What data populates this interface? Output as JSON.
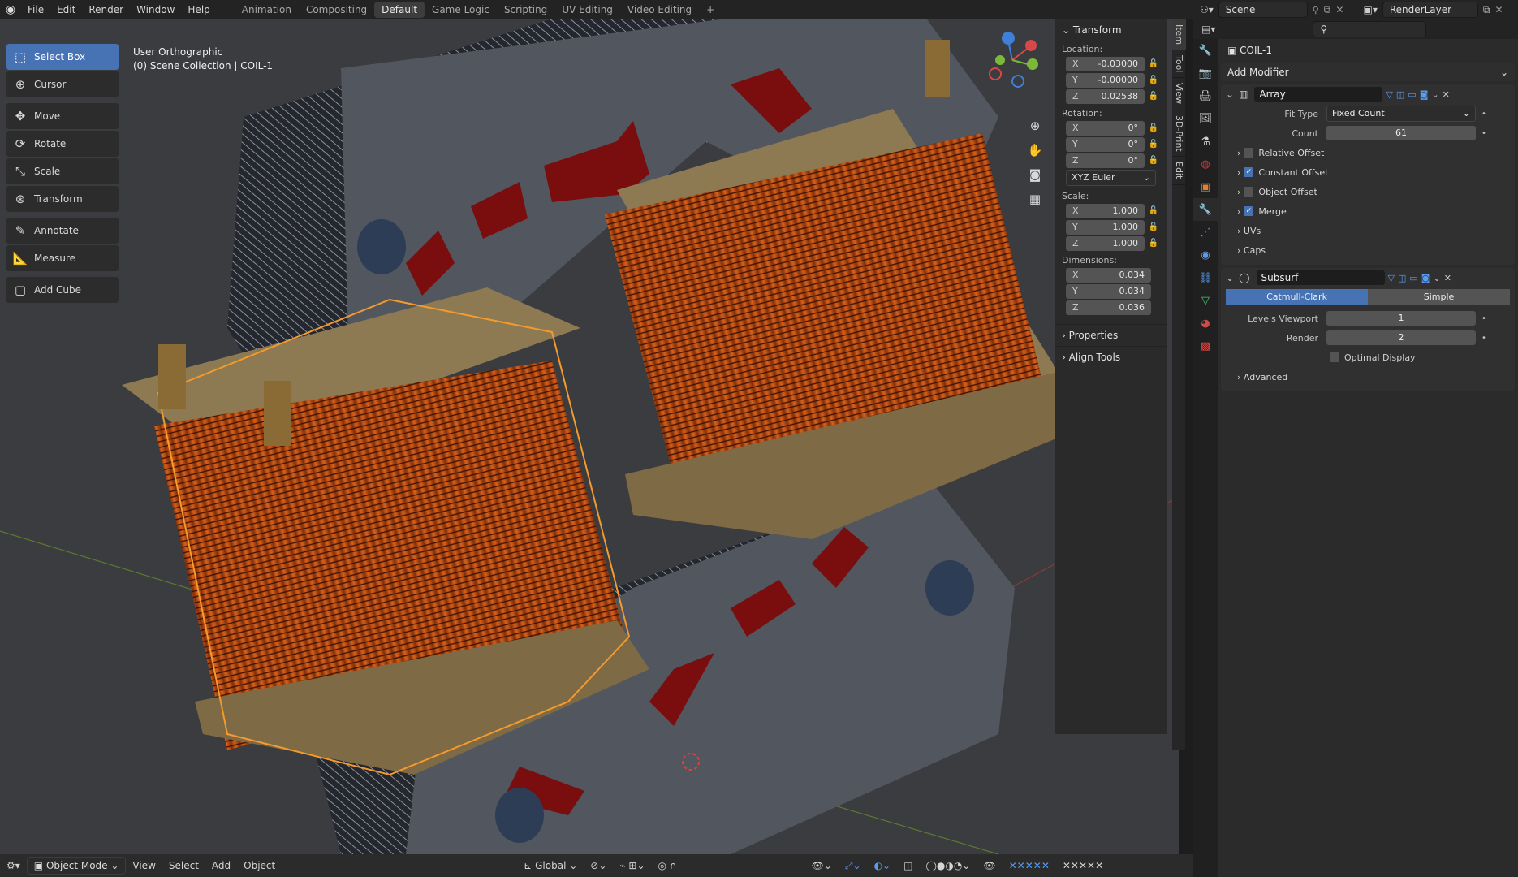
{
  "topbar": {
    "menus": [
      "File",
      "Edit",
      "Render",
      "Window",
      "Help"
    ],
    "tabs": [
      "Animation",
      "Compositing",
      "Default",
      "Game Logic",
      "Scripting",
      "UV Editing",
      "Video Editing"
    ],
    "active_tab": "Default",
    "add": "+",
    "scene": "Scene",
    "render_layer": "RenderLayer"
  },
  "toolbar": {
    "tools": [
      {
        "label": "Select Box",
        "icon": "select-box-icon",
        "active": true
      },
      {
        "label": "Cursor",
        "icon": "cursor-icon"
      },
      {
        "label": "Move",
        "icon": "move-icon"
      },
      {
        "label": "Rotate",
        "icon": "rotate-icon"
      },
      {
        "label": "Scale",
        "icon": "scale-icon"
      },
      {
        "label": "Transform",
        "icon": "transform-icon"
      },
      {
        "label": "Annotate",
        "icon": "annotate-icon"
      },
      {
        "label": "Measure",
        "icon": "measure-icon"
      },
      {
        "label": "Add Cube",
        "icon": "add-cube-icon"
      }
    ]
  },
  "viewport": {
    "view_name": "User Orthographic",
    "collection": "(0) Scene Collection | COIL-1"
  },
  "npanel": {
    "title": "Transform",
    "location_label": "Location:",
    "location": {
      "x": "-0.03000",
      "y": "-0.00000",
      "z": "0.02538"
    },
    "rotation_label": "Rotation:",
    "rotation": {
      "x": "0°",
      "y": "0°",
      "z": "0°"
    },
    "rotation_mode": "XYZ Euler",
    "scale_label": "Scale:",
    "scale": {
      "x": "1.000",
      "y": "1.000",
      "z": "1.000"
    },
    "dimensions_label": "Dimensions:",
    "dimensions": {
      "x": "0.034",
      "y": "0.034",
      "z": "0.036"
    },
    "properties": "Properties",
    "align_tools": "Align Tools",
    "tabs": [
      "Item",
      "Tool",
      "View",
      "3D-Print",
      "Edit"
    ],
    "axes": {
      "x": "X",
      "y": "Y",
      "z": "Z"
    }
  },
  "header": {
    "mode": "Object Mode",
    "menus": [
      "View",
      "Select",
      "Add",
      "Object"
    ],
    "orientation": "Global"
  },
  "props": {
    "object_name": "COIL-1",
    "add_modifier": "Add Modifier",
    "array": {
      "name": "Array",
      "fit_type_label": "Fit Type",
      "fit_type": "Fixed Count",
      "count_label": "Count",
      "count": "61",
      "relative_offset": "Relative Offset",
      "constant_offset": "Constant Offset",
      "object_offset": "Object Offset",
      "merge": "Merge",
      "uvs": "UVs",
      "caps": "Caps"
    },
    "subsurf": {
      "name": "Subsurf",
      "catmull": "Catmull-Clark",
      "simple": "Simple",
      "levels_viewport_label": "Levels Viewport",
      "levels_viewport": "1",
      "render_label": "Render",
      "render": "2",
      "optimal_display": "Optimal Display",
      "advanced": "Advanced"
    }
  }
}
